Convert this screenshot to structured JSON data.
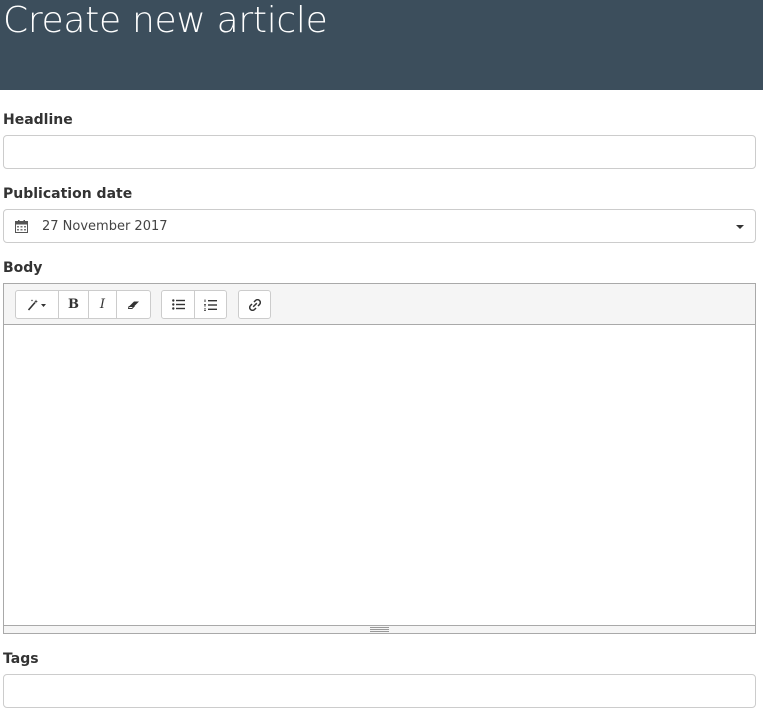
{
  "header": {
    "title": "Create new article"
  },
  "form": {
    "headline": {
      "label": "Headline",
      "value": "",
      "placeholder": ""
    },
    "publication_date": {
      "label": "Publication date",
      "value": "27 November 2017"
    },
    "body": {
      "label": "Body",
      "value": "",
      "toolbar": {
        "style_icon": "magic-wand-icon",
        "bold": "B",
        "italic": "I",
        "clear_icon": "eraser-icon",
        "unordered_list_icon": "unordered-list-icon",
        "ordered_list_icon": "ordered-list-icon",
        "link_icon": "link-icon"
      }
    },
    "tags": {
      "label": "Tags",
      "value": "",
      "placeholder": ""
    }
  },
  "colors": {
    "header_bg": "#3c4e5c",
    "border": "#cccccc",
    "toolbar_bg": "#f5f5f5"
  }
}
